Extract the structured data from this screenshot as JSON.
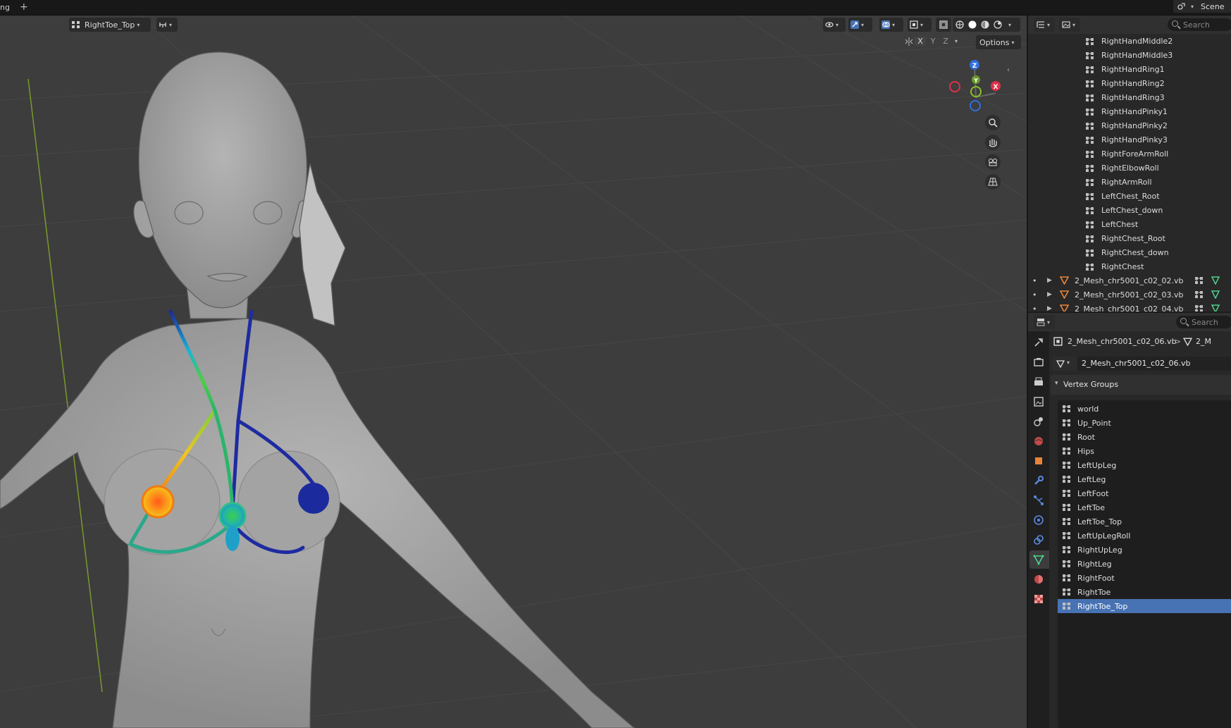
{
  "topbar": {
    "tab_fragment": "ng",
    "add_tab": "+",
    "scene_label": "Scene"
  },
  "viewport": {
    "active_group": "RightToe_Top",
    "axes": [
      "X",
      "Y",
      "Z"
    ],
    "options_label": "Options",
    "gizmo": {
      "z": "Z",
      "y": "Y",
      "x": "X"
    }
  },
  "outliner": {
    "search_placeholder": "Search",
    "bones": [
      "RightHandMiddle2",
      "RightHandMiddle3",
      "RightHandRing1",
      "RightHandRing2",
      "RightHandRing3",
      "RightHandPinky1",
      "RightHandPinky2",
      "RightHandPinky3",
      "RightForeArmRoll",
      "RightElbowRoll",
      "RightArmRoll",
      "LeftChest_Root",
      "LeftChest_down",
      "LeftChest",
      "RightChest_Root",
      "RightChest_down",
      "RightChest"
    ],
    "meshes": [
      "2_Mesh_chr5001_c02_02.vb",
      "2_Mesh_chr5001_c02_03.vb",
      "2_Mesh_chr5001_c02_04.vb"
    ]
  },
  "properties": {
    "search_placeholder": "Search",
    "breadcrumb_object": "2_Mesh_chr5001_c02_06.vb",
    "breadcrumb_sep": ">",
    "breadcrumb_data": "2_M",
    "mesh_data_name": "2_Mesh_chr5001_c02_06.vb",
    "vertex_groups_title": "Vertex Groups",
    "vertex_groups": [
      "world",
      "Up_Point",
      "Root",
      "Hips",
      "LeftUpLeg",
      "LeftLeg",
      "LeftFoot",
      "LeftToe",
      "LeftToe_Top",
      "LeftUpLegRoll",
      "RightUpLeg",
      "RightLeg",
      "RightFoot",
      "RightToe",
      "RightToe_Top"
    ],
    "selected_group": "RightToe_Top"
  },
  "colors": {
    "selection": "#4772b3",
    "viewport_bg": "#3d3d3d",
    "panel_bg": "#282828",
    "mesh_icon": "#e8843a",
    "data_icon": "#4fd08a"
  }
}
